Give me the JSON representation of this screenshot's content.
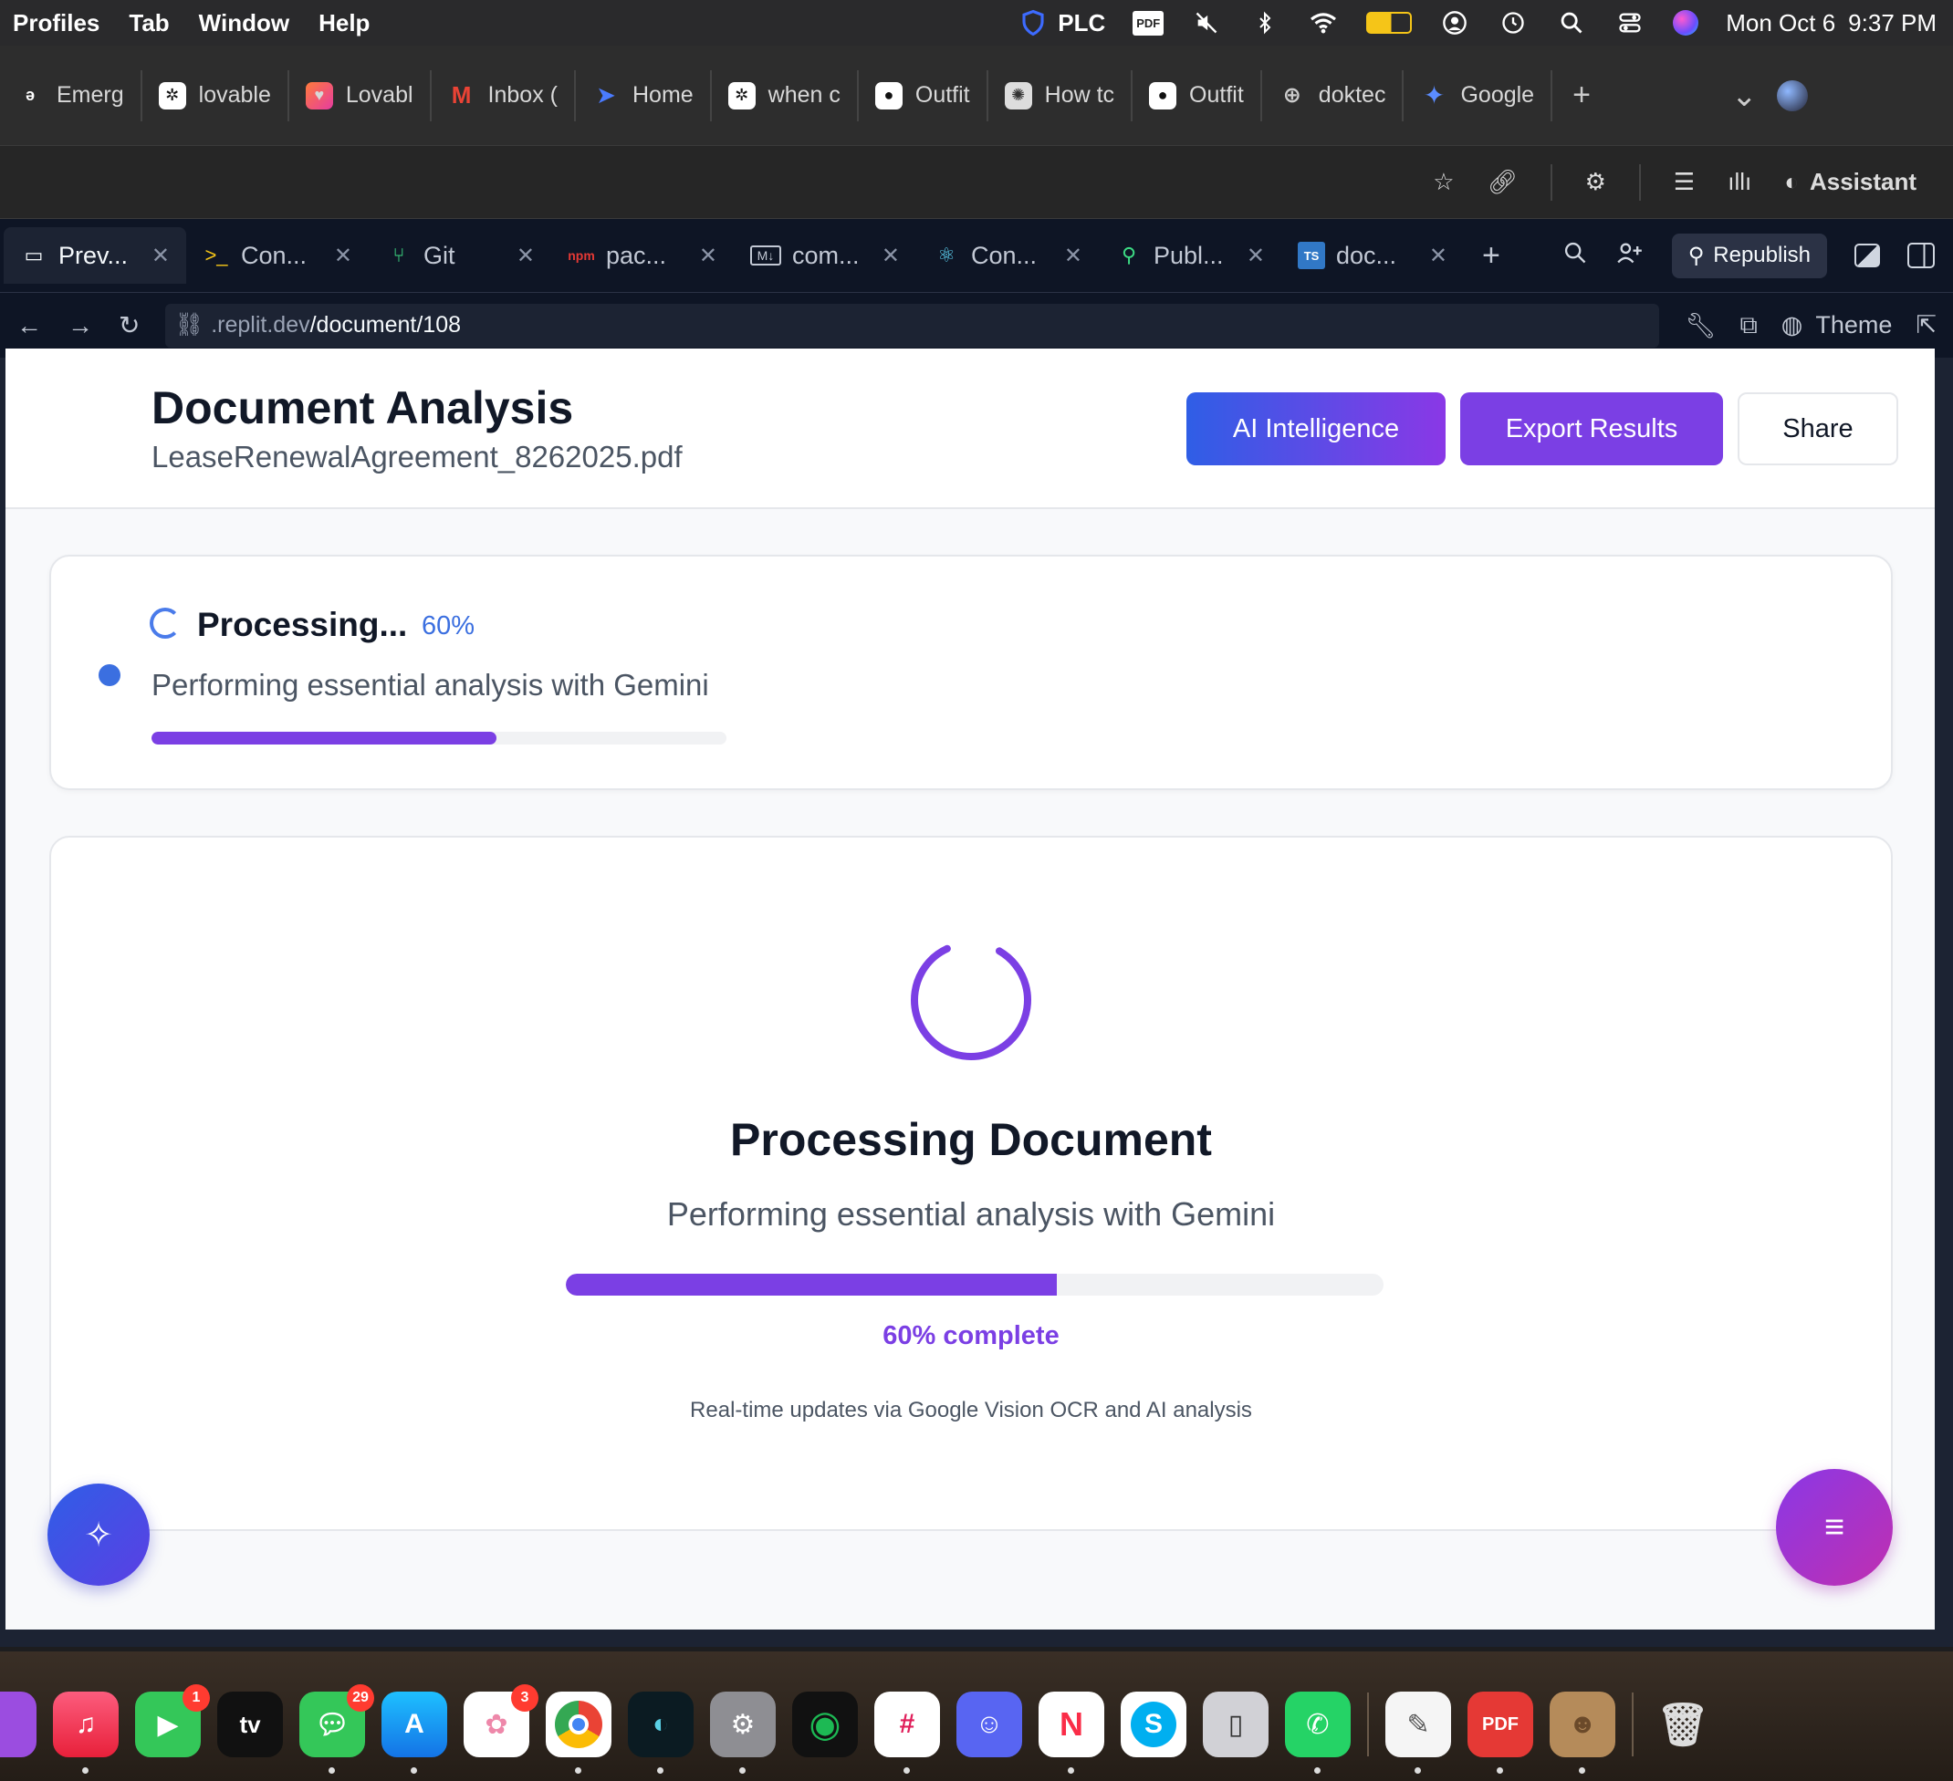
{
  "menubar": {
    "items": [
      "Profiles",
      "Tab",
      "Window",
      "Help"
    ],
    "vpn_label": "PLC",
    "pdf_badge": "PDF",
    "date": "Mon Oct 6",
    "time": "9:37 PM"
  },
  "browser_tabs": [
    {
      "label": "Emerg",
      "icon": "emergent-icon"
    },
    {
      "label": "lovable",
      "icon": "lovable-icon"
    },
    {
      "label": "Lovabl",
      "icon": "lovable-heart-icon"
    },
    {
      "label": "Inbox (",
      "icon": "gmail-icon"
    },
    {
      "label": "Home",
      "icon": "home-icon"
    },
    {
      "label": "when c",
      "icon": "openai-icon"
    },
    {
      "label": "Outfit",
      "icon": "outfit-icon"
    },
    {
      "label": "How tc",
      "icon": "claude-icon"
    },
    {
      "label": "Outfit",
      "icon": "outfit-icon"
    },
    {
      "label": "doktec",
      "icon": "globe-icon"
    },
    {
      "label": "Google",
      "icon": "gemini-icon"
    }
  ],
  "toolbar2": {
    "assistant_label": "Assistant"
  },
  "replit_tabs": [
    {
      "label": "Prev...",
      "active": true,
      "icon": "monitor-icon"
    },
    {
      "label": "Con...",
      "icon": "terminal-icon"
    },
    {
      "label": "Git",
      "icon": "git-icon"
    },
    {
      "label": "pac...",
      "icon": "npm-icon"
    },
    {
      "label": "com...",
      "icon": "markdown-icon"
    },
    {
      "label": "Con...",
      "icon": "react-icon"
    },
    {
      "label": "Publ...",
      "icon": "publish-icon"
    },
    {
      "label": "doc...",
      "icon": "typescript-icon"
    }
  ],
  "republish_label": "Republish",
  "url": {
    "prefix": ".replit.dev",
    "path": "/document/108"
  },
  "theme_label": "Theme",
  "app": {
    "title": "Document Analysis",
    "filename": "LeaseRenewalAgreement_8262025.pdf",
    "buttons": {
      "ai": "AI Intelligence",
      "export": "Export Results",
      "share": "Share"
    },
    "status_card": {
      "title": "Processing...",
      "percent_text": "60%",
      "status": "Performing essential analysis with Gemini",
      "progress": 0.6
    },
    "main_card": {
      "title": "Processing Document",
      "status": "Performing essential analysis with Gemini",
      "progress": 0.6,
      "complete_text": "60% complete",
      "note": "Real-time updates via Google Vision OCR and AI analysis"
    }
  },
  "colors": {
    "accent_purple": "#7b3fe4",
    "accent_blue": "#3b6fe0"
  },
  "dock": {
    "apps": [
      {
        "name": "music",
        "badge": null
      },
      {
        "name": "facetime",
        "badge": "1"
      },
      {
        "name": "apple-tv",
        "badge": null
      },
      {
        "name": "messages",
        "badge": "29"
      },
      {
        "name": "app-store",
        "badge": null
      },
      {
        "name": "photos",
        "badge": "3"
      },
      {
        "name": "chrome",
        "badge": null
      },
      {
        "name": "app-c",
        "badge": null
      },
      {
        "name": "system-settings",
        "badge": null
      },
      {
        "name": "spotify",
        "badge": null
      },
      {
        "name": "slack",
        "badge": null
      },
      {
        "name": "discord",
        "badge": null
      },
      {
        "name": "news",
        "badge": null
      },
      {
        "name": "skype",
        "badge": null
      },
      {
        "name": "iphone-mirroring",
        "badge": null
      },
      {
        "name": "whatsapp",
        "badge": null
      },
      {
        "name": "textedit",
        "badge": null
      },
      {
        "name": "pdf-expert",
        "badge": null
      },
      {
        "name": "contacts",
        "badge": null
      },
      {
        "name": "trash",
        "badge": null
      }
    ],
    "pdf_text": "PDF"
  }
}
